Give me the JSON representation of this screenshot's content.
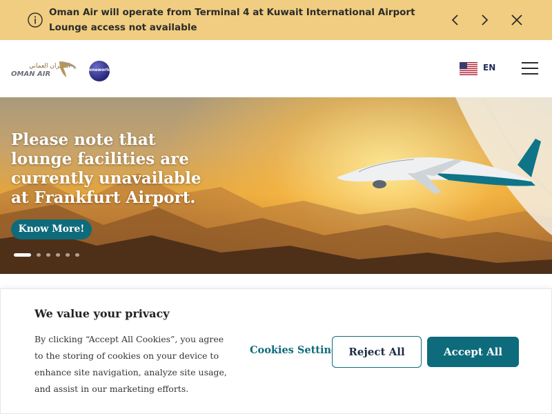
{
  "alert": {
    "message": "Oman Air will operate from Terminal 4 at Kuwait International Airport Lounge access not available",
    "info_icon": "info-icon",
    "prev_icon": "chevron-left-icon",
    "next_icon": "chevron-right-icon",
    "close_icon": "close-icon"
  },
  "header": {
    "logo_text": "OMAN AIR",
    "logo_arabic": "الطيران العماني",
    "partner_logo": "oneworld",
    "language": "EN",
    "flag": "us-flag-icon",
    "menu_icon": "hamburger-menu-icon"
  },
  "hero": {
    "headline": "Please note that lounge facilities are currently unavailable at Frankfurt Airport.",
    "cta_label": "Know More!",
    "slide_count": 6,
    "active_slide": 1
  },
  "cookie_banner": {
    "title": "We value your privacy",
    "body": "By clicking “Accept All Cookies”, you agree to the storing of cookies on your device to enhance site navigation, analyze site usage, and assist in our marketing efforts.",
    "settings_label": "Cookies Settings",
    "reject_label": "Reject All",
    "accept_label": "Accept All"
  },
  "colors": {
    "alert_bg": "#f0cd80",
    "brand_teal": "#0e6b7c",
    "brand_gold": "#b8965a"
  }
}
